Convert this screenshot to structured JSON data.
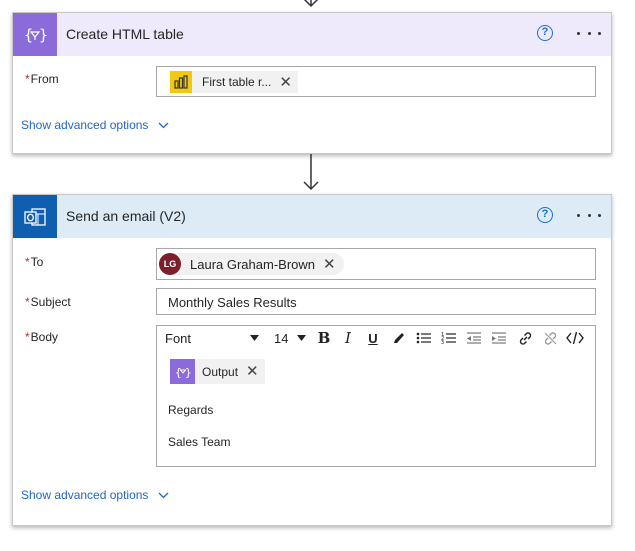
{
  "card1": {
    "title": "Create HTML table",
    "from_label": "From",
    "from_token": "First table r...",
    "advanced": "Show advanced options"
  },
  "card2": {
    "title": "Send an email (V2)",
    "to_label": "To",
    "to_avatar": "LG",
    "to_name": "Laura Graham-Brown",
    "subject_label": "Subject",
    "subject_value": "Monthly Sales Results",
    "body_label": "Body",
    "toolbar": {
      "font": "Font",
      "size": "14",
      "bold": "B",
      "italic": "I",
      "underline": "U"
    },
    "body_token": "Output",
    "body_lines": [
      "Regards",
      "Sales Team"
    ],
    "advanced": "Show advanced options"
  },
  "colors": {
    "html_table_accent": "#8b6ad9",
    "html_table_header_bg": "#efeafb",
    "email_accent": "#0f5fb0",
    "email_header_bg": "#dcebf6",
    "powerbi_yellow": "#f2c811",
    "avatar": "#7a1f2b",
    "link": "#2266c8",
    "required": "#c4262e"
  },
  "icons": [
    "down-arrow-icon",
    "html-table-icon",
    "help-icon",
    "more-icon",
    "power-bi-icon",
    "close-icon",
    "chevron-down-icon",
    "outlook-icon",
    "avatar",
    "bold-icon",
    "italic-icon",
    "underline-icon",
    "highlight-icon",
    "bullet-list-icon",
    "numbered-list-icon",
    "decrease-indent-icon",
    "increase-indent-icon",
    "link-icon",
    "unlink-icon",
    "code-view-icon"
  ]
}
